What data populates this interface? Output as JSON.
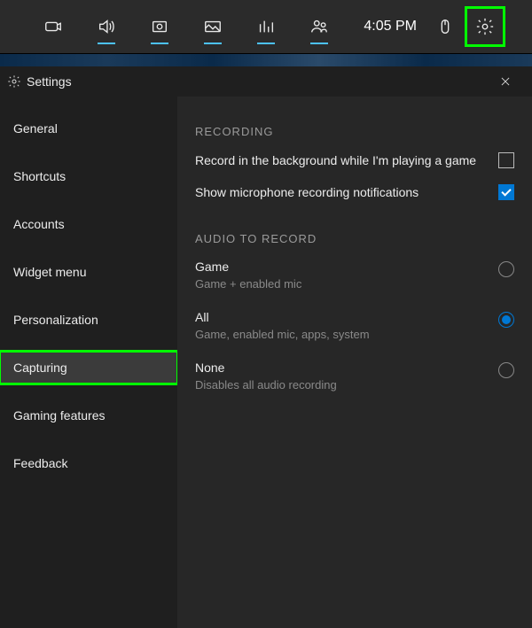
{
  "toolbar": {
    "time": "4:05 PM",
    "items": [
      {
        "name": "xbox-widget-icon",
        "active": false
      },
      {
        "name": "audio-icon",
        "active": true
      },
      {
        "name": "capture-icon",
        "active": true
      },
      {
        "name": "gallery-icon",
        "active": true
      },
      {
        "name": "performance-icon",
        "active": true
      },
      {
        "name": "social-icon",
        "active": true
      }
    ]
  },
  "panel": {
    "title": "Settings"
  },
  "sidebar": {
    "items": [
      {
        "label": "General",
        "active": false
      },
      {
        "label": "Shortcuts",
        "active": false
      },
      {
        "label": "Accounts",
        "active": false
      },
      {
        "label": "Widget menu",
        "active": false
      },
      {
        "label": "Personalization",
        "active": false
      },
      {
        "label": "Capturing",
        "active": true,
        "highlight": true
      },
      {
        "label": "Gaming features",
        "active": false
      },
      {
        "label": "Feedback",
        "active": false
      }
    ]
  },
  "content": {
    "recording_heading": "RECORDING",
    "checks": [
      {
        "label": "Record in the background while I'm playing a game",
        "checked": false
      },
      {
        "label": "Show microphone recording notifications",
        "checked": true
      }
    ],
    "audio_heading": "AUDIO TO RECORD",
    "radios": [
      {
        "title": "Game",
        "sub": "Game + enabled mic",
        "selected": false
      },
      {
        "title": "All",
        "sub": "Game, enabled mic, apps, system",
        "selected": true
      },
      {
        "title": "None",
        "sub": "Disables all audio recording",
        "selected": false
      }
    ]
  },
  "highlight_color": "#00ff00",
  "accent_color": "#0078d4"
}
